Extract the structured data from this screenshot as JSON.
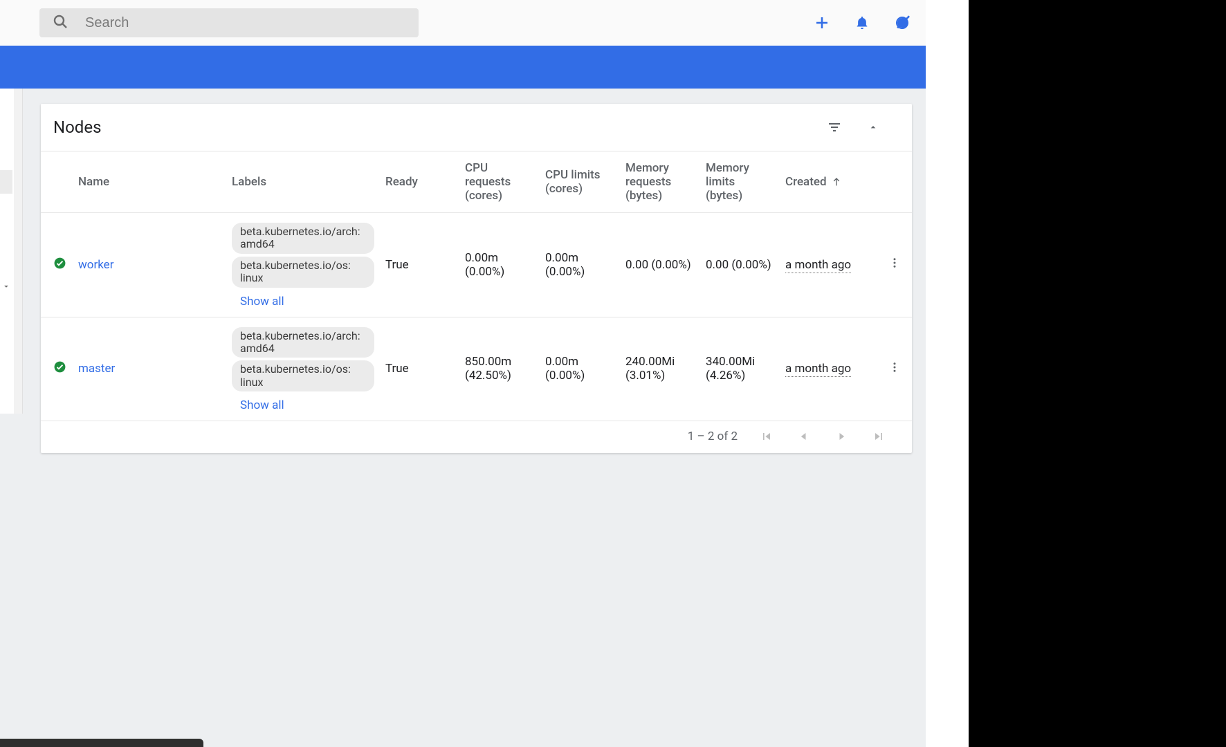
{
  "search": {
    "placeholder": "Search"
  },
  "card": {
    "title": "Nodes",
    "columns": {
      "name": "Name",
      "labels": "Labels",
      "ready": "Ready",
      "cpu_req": "CPU requests (cores)",
      "cpu_lim": "CPU limits (cores)",
      "mem_req": "Memory requests (bytes)",
      "mem_lim": "Memory limits (bytes)",
      "created": "Created"
    },
    "rows": [
      {
        "name": "worker",
        "labels": [
          "beta.kubernetes.io/arch: amd64",
          "beta.kubernetes.io/os: linux"
        ],
        "showall": "Show all",
        "ready": "True",
        "cpu_req": "0.00m (0.00%)",
        "cpu_lim": "0.00m (0.00%)",
        "mem_req": "0.00 (0.00%)",
        "mem_lim": "0.00 (0.00%)",
        "created": "a month ago"
      },
      {
        "name": "master",
        "labels": [
          "beta.kubernetes.io/arch: amd64",
          "beta.kubernetes.io/os: linux"
        ],
        "showall": "Show all",
        "ready": "True",
        "cpu_req": "850.00m (42.50%)",
        "cpu_lim": "0.00m (0.00%)",
        "mem_req": "240.00Mi (3.01%)",
        "mem_lim": "340.00Mi (4.26%)",
        "created": "a month ago"
      }
    ],
    "pagination": "1 – 2 of 2"
  }
}
